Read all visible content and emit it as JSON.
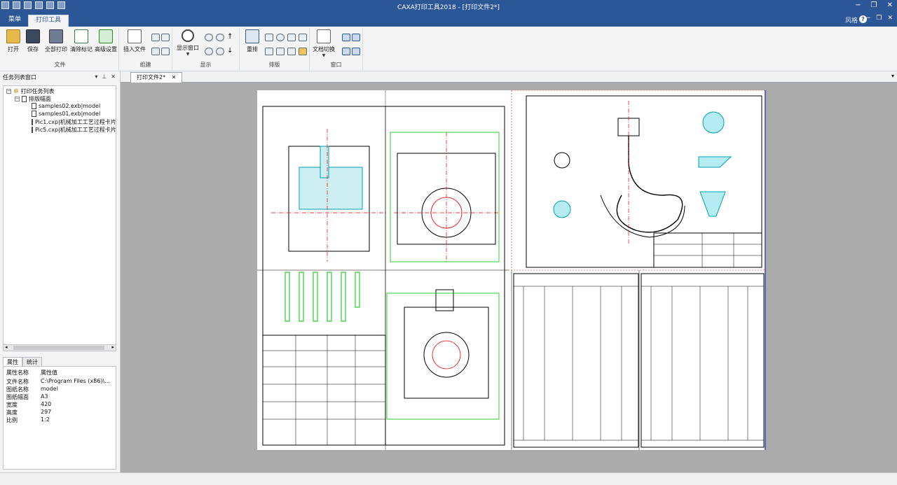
{
  "window": {
    "title": "CAXA打印工具2018 - [打印文件2*]",
    "accent": "#2b5797"
  },
  "menubar": {
    "menu_tab": "菜单",
    "print_tool_tab": "打印工具",
    "style_label": "风格"
  },
  "ribbon": {
    "groups": {
      "file": "文件",
      "build": "组建",
      "display": "显示",
      "arrange": "排版",
      "window": "窗口"
    },
    "buttons": {
      "open": "打开",
      "save": "保存",
      "print_all": "全部打印",
      "clear_marks": "清除标记",
      "advanced": "高级设置",
      "insert_file": "插入文件",
      "display_window": "显示窗口",
      "rearrange": "重排",
      "doc_switch": "文档切换"
    }
  },
  "left_panel": {
    "title": "任务列表窗口",
    "tree": {
      "root": "打印任务列表",
      "layout": "排版幅面",
      "items": [
        "samples02.exb|model",
        "samples01.exb|model",
        "Pic1.cxp|机械加工工艺过程卡片",
        "Pic5.cxp|机械加工工艺过程卡片"
      ]
    },
    "tabs": [
      "属性",
      "统计"
    ],
    "properties": {
      "header": [
        "属性名称",
        "属性值"
      ],
      "rows": [
        {
          "k": "文件名称",
          "v": "C:\\Program Files (x86)\\..."
        },
        {
          "k": "图纸名称",
          "v": "model"
        },
        {
          "k": "图纸幅面",
          "v": "A3"
        },
        {
          "k": "宽度",
          "v": "420"
        },
        {
          "k": "高度",
          "v": "297"
        },
        {
          "k": "比例",
          "v": "1:2"
        }
      ]
    }
  },
  "document": {
    "tab": "打印文件2*"
  }
}
